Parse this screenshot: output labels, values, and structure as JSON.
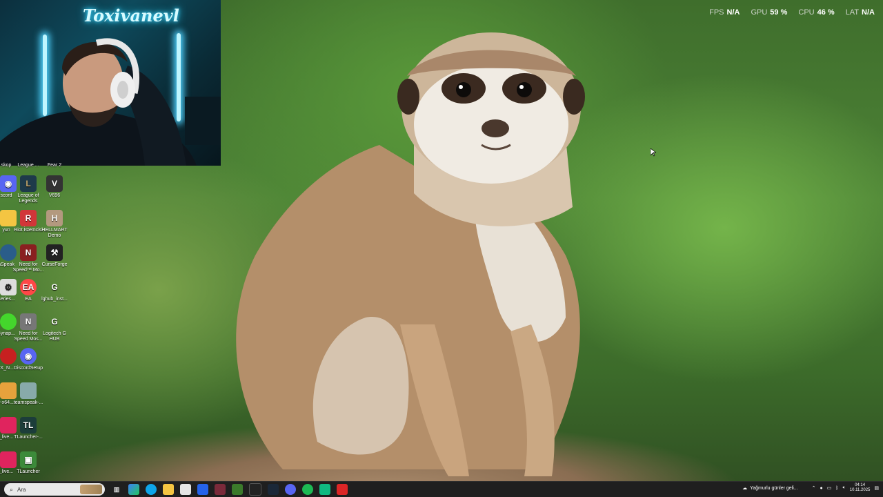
{
  "overlay": {
    "fps": {
      "label": "FPS",
      "value": "N/A"
    },
    "gpu": {
      "label": "GPU",
      "value": "59 %"
    },
    "cpu": {
      "label": "CPU",
      "value": "46 %"
    },
    "lat": {
      "label": "LAT",
      "value": "N/A"
    }
  },
  "webcam": {
    "logo_text": "Toxivanevl"
  },
  "desktop_icons": {
    "top_partial_1": "skop",
    "top_partial_2": "League ...",
    "top_partial_3": "Fear 2",
    "discord_partial": "scord",
    "league": "League of Legends",
    "v696": "V696",
    "yun_partial": "yun",
    "riot": "Riot İstemcisi",
    "hellmart": "HELLMART Demo",
    "speak_partial": "nSpeak",
    "nfs_most": "Need for Speed™ Mo...",
    "curseforge": "CurseForge",
    "series_partial": "Series...",
    "ea": "EA",
    "lghub_inst": "lghub_inst...",
    "synap_partial": "Synap...",
    "nfs_most2": "Need for Speed Mos...",
    "logitech": "Logitech G HUB",
    "xn_partial": "rX_N...",
    "discordsetup": "DiscordSetup",
    "x64_partial": "r-x64...",
    "teamspeak": "teamspeak-...",
    "live_partial_1": "_live...",
    "tlauncher_inst": "TLauncher-...",
    "live_partial_2": "_live...",
    "tlauncher": "TLauncher"
  },
  "taskbar": {
    "search_placeholder": "Ara",
    "weather_text": "Yağmurlu günler geli...",
    "time": "04:14",
    "date": "10.11.2025"
  },
  "colors": {
    "taskbar_bg": "#1f1f1f",
    "webcam_neon": "#4fd3ff"
  }
}
